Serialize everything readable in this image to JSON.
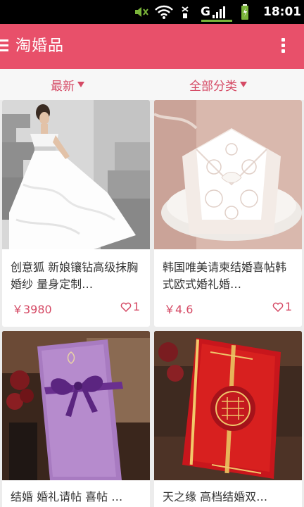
{
  "statusbar": {
    "network": "G",
    "time": "18:01",
    "icons": [
      "mute-icon",
      "wifi-icon",
      "sim-icon",
      "signal-icon",
      "battery-charging-icon"
    ]
  },
  "actionbar": {
    "title": "淘婚品",
    "menu_icon": "menu-icon",
    "overflow_icon": "overflow-icon"
  },
  "filters": {
    "latest": "最新",
    "category": "全部分类"
  },
  "products": [
    {
      "title": "创意狐 新娘镶钻高级抹胸婚纱 量身定制…",
      "price": "￥3980",
      "likes": "1",
      "image": "wedding-dress-photo"
    },
    {
      "title": "韩国唯美请柬结婚喜帖韩式欧式婚礼婚…",
      "price": "￥4.6",
      "likes": "1",
      "image": "lace-invitation-photo"
    },
    {
      "title": "结婚 婚礼请帖 喜帖 …",
      "image": "purple-invitation-photo"
    },
    {
      "title": "天之缘 高档结婚双…",
      "image": "red-invitation-photo"
    }
  ],
  "colors": {
    "accent": "#e8506a",
    "accent_text": "#d54a65",
    "statusbar": "#000000"
  }
}
